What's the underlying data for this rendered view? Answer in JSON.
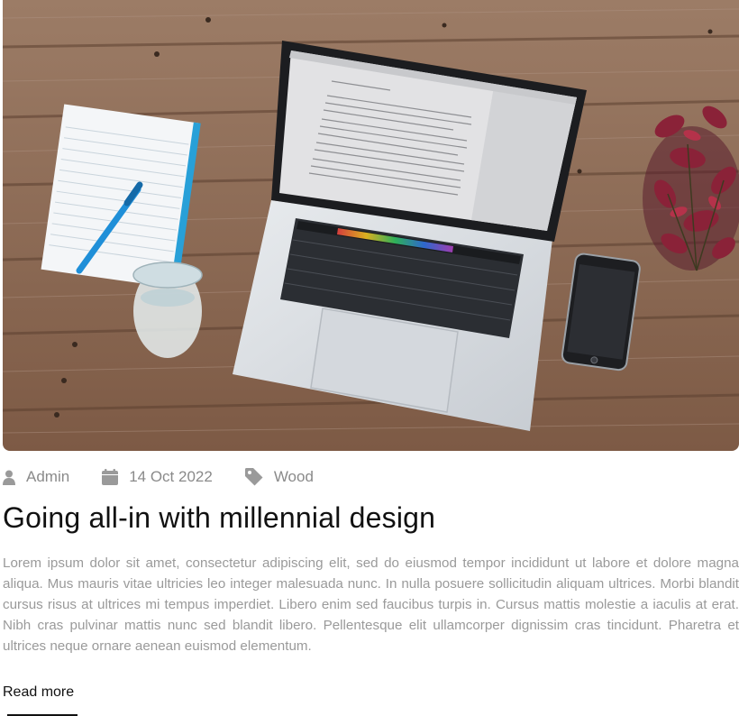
{
  "post": {
    "image": {
      "icon": "laptop-desk-photo"
    },
    "meta": {
      "author": "Admin",
      "author_icon": "user-icon",
      "date": "14 Oct 2022",
      "date_icon": "calendar-icon",
      "category": "Wood",
      "category_icon": "tag-icon"
    },
    "title": "Going all-in with millennial design",
    "excerpt": "Lorem ipsum dolor sit amet, consectetur adipiscing elit, sed do eiusmod tempor incididunt ut labore et dolore magna aliqua. Mus mauris vitae ultricies leo integer malesuada nunc. In nulla posuere sollicitudin aliquam ultrices. Morbi blandit cursus risus at ultrices mi tempus imperdiet. Libero enim sed faucibus turpis in. Cursus mattis molestie a iaculis at erat. Nibh cras pulvinar mattis nunc sed blandit libero. Pellentesque elit ullamcorper dignissim cras tincidunt. Pharetra et ultrices neque ornare aenean euismod elementum.",
    "read_more": "Read more"
  },
  "colors": {
    "meta_text": "#8a8a8a",
    "title": "#111111",
    "excerpt": "#9a9a9a",
    "wood": "#8c6a55"
  }
}
